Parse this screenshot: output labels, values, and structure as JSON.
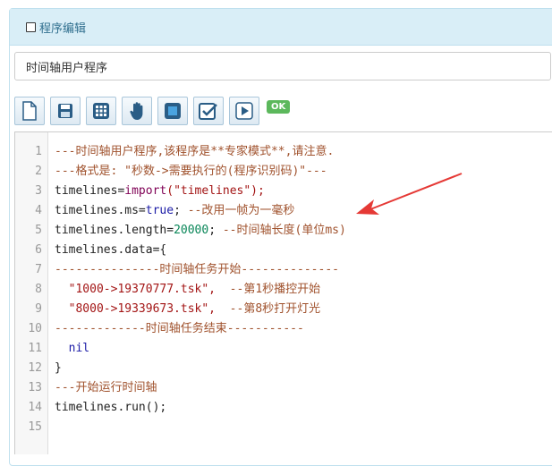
{
  "panel": {
    "title": "程序编辑"
  },
  "program_name": {
    "value": "时间轴用户程序"
  },
  "toolbar": {
    "buttons": [
      {
        "icon": "new-file-icon"
      },
      {
        "icon": "save-icon"
      },
      {
        "icon": "grid-icon"
      },
      {
        "icon": "hand-icon"
      },
      {
        "icon": "stop-icon"
      },
      {
        "icon": "check-icon"
      },
      {
        "icon": "play-icon"
      }
    ],
    "ok_label": "OK"
  },
  "colors": {
    "header_bg": "#d9eef7",
    "header_text": "#31708f",
    "ok_green": "#5cb85c",
    "comment": "#a0522d",
    "arrow": "#e53935"
  },
  "editor": {
    "line_numbers": [
      "1",
      "2",
      "3",
      "4",
      "5",
      "6",
      "7",
      "8",
      "9",
      "10",
      "11",
      "12",
      "13",
      "14",
      "15"
    ],
    "lines": {
      "l1": "---时间轴用户程序,该程序是**专家模式**,请注意.",
      "l2": "---格式是: \"秒数->需要执行的(程序识别码)\"---",
      "l3a": "timelines=",
      "l3b": "import",
      "l3c": "(\"timelines\");",
      "l4a": "timelines.ms=",
      "l4b": "true",
      "l4c": "; ",
      "l4d": "--改用一帧为一毫秒",
      "l5a": "timelines.length=",
      "l5b": "20000",
      "l5c": "; ",
      "l5d": "--时间轴长度(单位ms)",
      "l6": "timelines.data={",
      "l7": "---------------时间轴任务开始--------------",
      "l8a": "  \"1000->19370777.tsk\",",
      "l8b": "  --第1秒播控开始",
      "l9a": "  \"8000->19339673.tsk\",",
      "l9b": "  --第8秒打开灯光",
      "l10": "-------------时间轴任务结束-----------",
      "l11": "  nil",
      "l12": "}",
      "l13": "---开始运行时间轴",
      "l14": "timelines.run();",
      "l15": ""
    }
  }
}
